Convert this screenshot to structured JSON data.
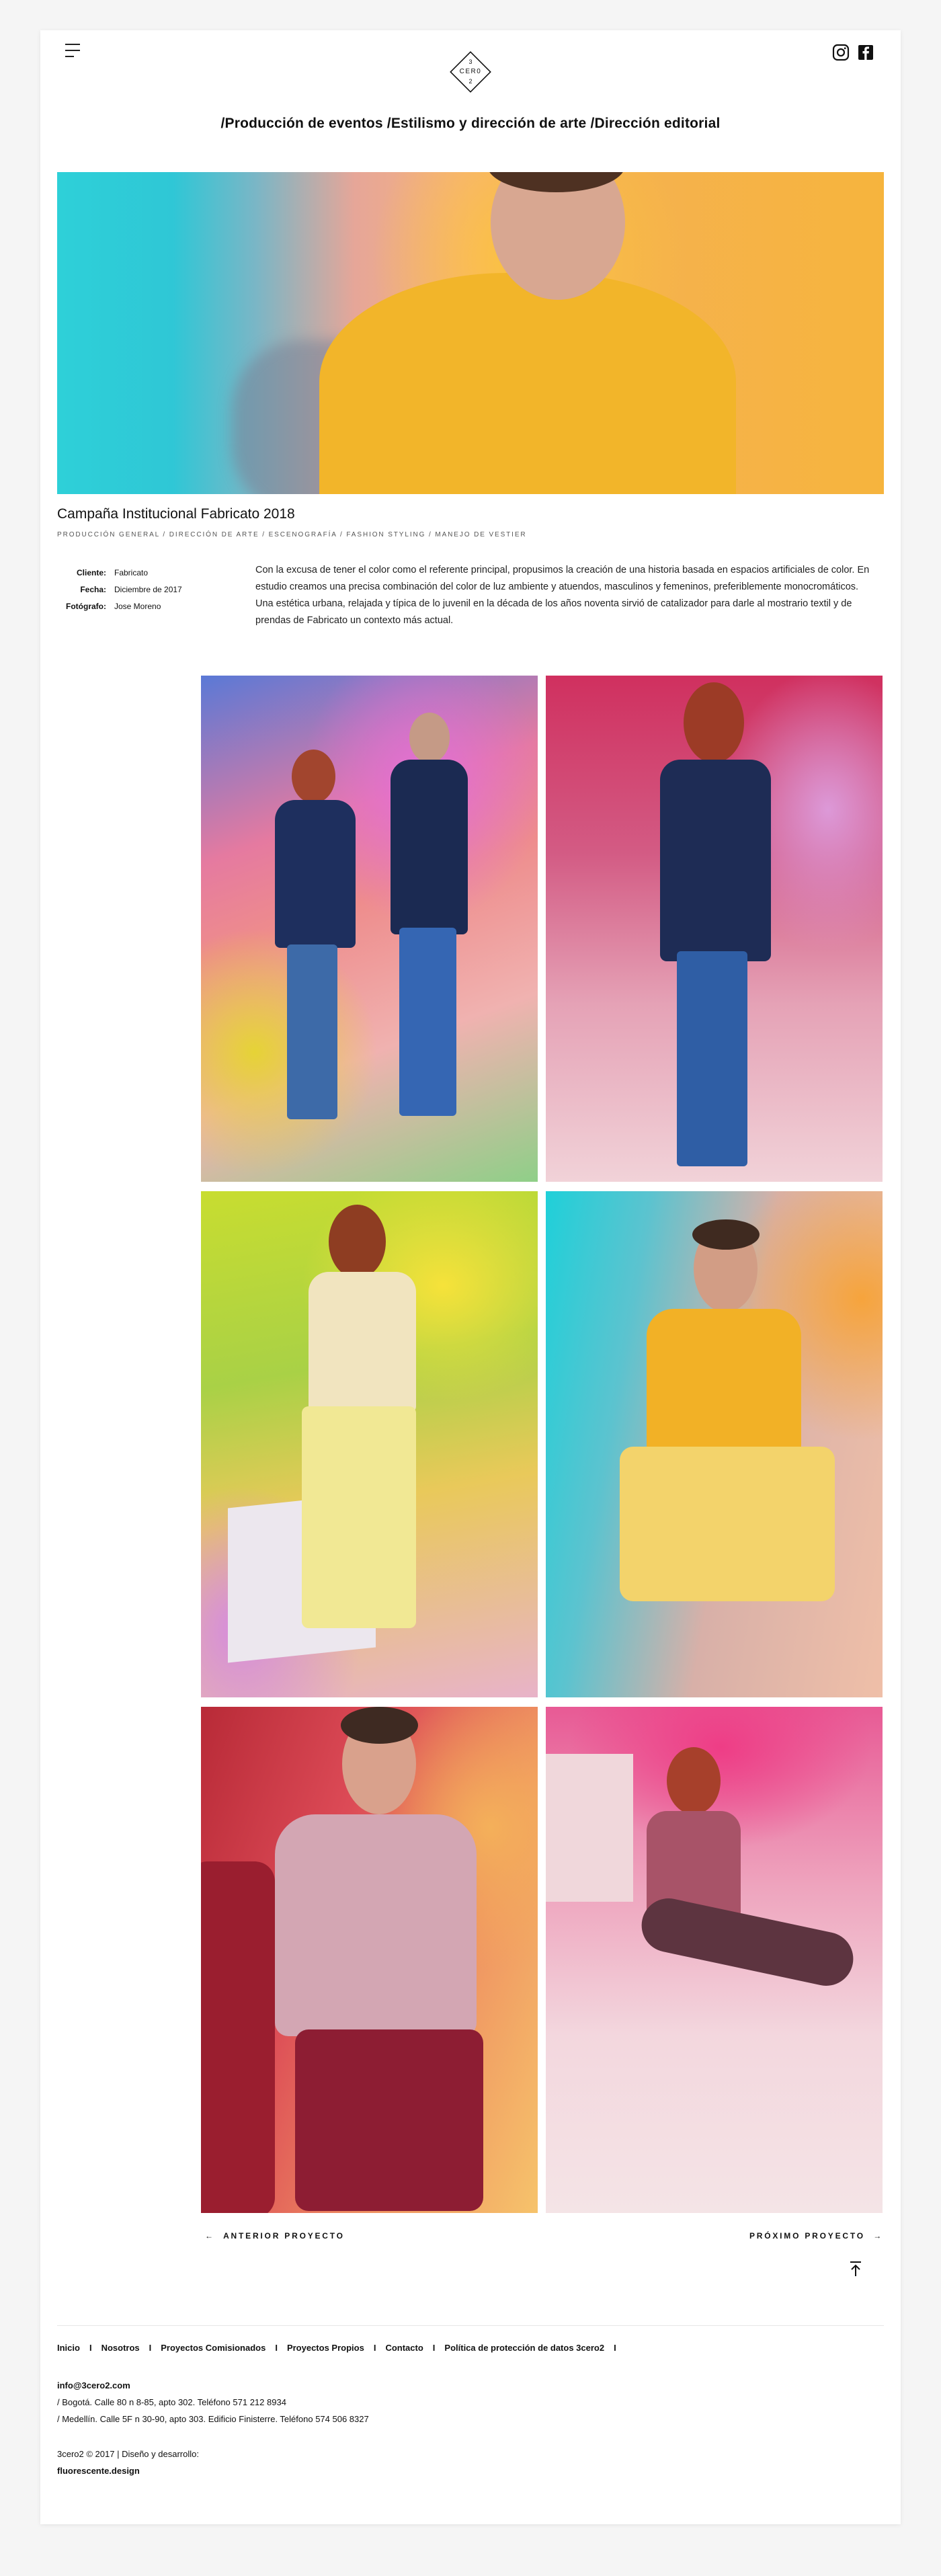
{
  "header": {
    "logo_letters": [
      "3",
      "CER0",
      "2"
    ],
    "nav_text": "/Producción de eventos /Estilismo y dirección de arte /Dirección editorial",
    "icons": [
      "menu-icon",
      "instagram-icon",
      "facebook-icon"
    ]
  },
  "project": {
    "title": "Campaña Institucional Fabricato 2018",
    "tags": "PRODUCCIÓN GENERAL / DIRECCIÓN DE ARTE / ESCENOGRAFÍA / FASHION STYLING / MANEJO DE VESTIER",
    "meta": [
      {
        "key": "Cliente:",
        "value": "Fabricato"
      },
      {
        "key": "Fecha:",
        "value": "Diciembre de 2017"
      },
      {
        "key": "Fotógrafo:",
        "value": "Jose Moreno"
      }
    ],
    "description": "Con la excusa de tener el color como el referente principal, propusimos la creación de una historia basada en espacios artificiales de color. En estudio creamos una precisa combinación del color de luz ambiente y atuendos, masculinos y femeninos, preferiblemente monocromáticos. Una estética urbana, relajada y típica de lo juvenil en la década de los años noventa sirvió de catalizador para darle al mostrario textil y de prendas de Fabricato un contexto más actual."
  },
  "pagination": {
    "prev_label": "ANTERIOR PROYECTO",
    "next_label": "PRÓXIMO PROYECTO"
  },
  "footer": {
    "nav": [
      "Inicio",
      "Nosotros",
      "Proyectos Comisionados",
      "Proyectos Propios",
      "Contacto",
      "Política de protección de datos 3cero2"
    ],
    "separator": "I",
    "email": "info@3cero2.com",
    "address_bogota": "/ Bogotá. Calle 80 n 8-85, apto 302. Teléfono 571 212 8934",
    "address_medellin": "/ Medellín. Calle 5F n 30-90, apto 303. Edificio Finisterre. Teléfono 574 506 8327",
    "copyright": "3cero2 © 2017 | Diseño y desarrollo:",
    "developer": "fluorescente.design"
  },
  "colors": {
    "accent_yellow": "#f2b52a",
    "accent_cyan": "#2ed0d8",
    "accent_pink": "#e0407a"
  }
}
